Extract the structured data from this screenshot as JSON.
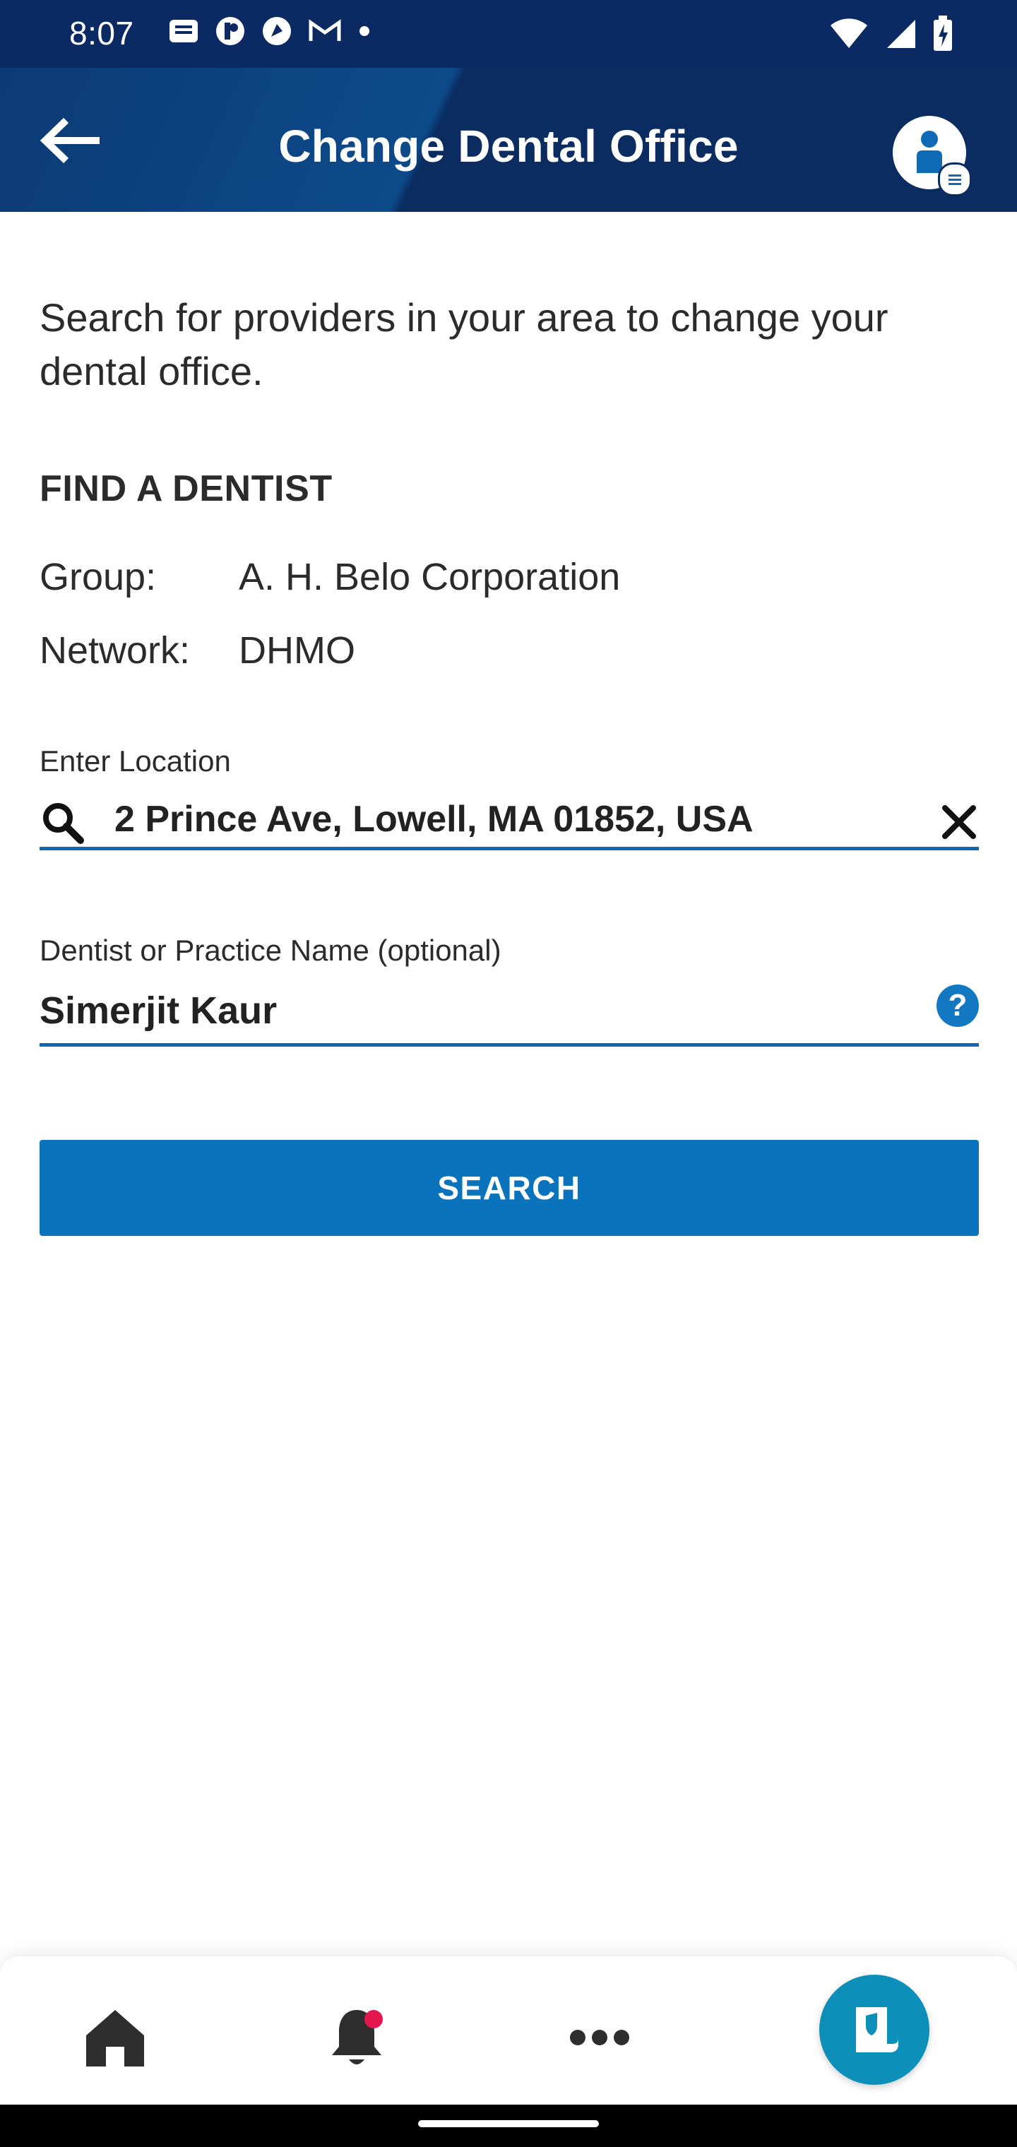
{
  "status_bar": {
    "time": "8:07"
  },
  "header": {
    "title": "Change Dental Office"
  },
  "intro": {
    "text": "Search for providers in your area to change your dental office."
  },
  "find_dentist": {
    "title": "FIND A DENTIST",
    "group_label": "Group:",
    "group_value": "A. H. Belo Corporation",
    "network_label": "Network:",
    "network_value": "DHMO"
  },
  "location_field": {
    "label": "Enter Location",
    "value": "2 Prince Ave, Lowell, MA 01852, USA"
  },
  "dentist_field": {
    "label": "Dentist or Practice Name (optional)",
    "value": "Simerjit Kaur"
  },
  "search_button": {
    "label": "SEARCH"
  },
  "colors": {
    "header_bg": "#0a2c61",
    "accent": "#0a73bb",
    "field_line": "#0f67b4",
    "notification": "#e3174d",
    "card_button": "#0c8fb8"
  },
  "icons": {
    "back": "back-arrow-icon",
    "profile": "user-profile-icon",
    "search": "search-icon",
    "clear": "close-icon",
    "help": "help-icon",
    "home": "home-icon",
    "notifications": "bell-icon",
    "more": "more-dots-icon",
    "id_card": "id-card-icon"
  }
}
